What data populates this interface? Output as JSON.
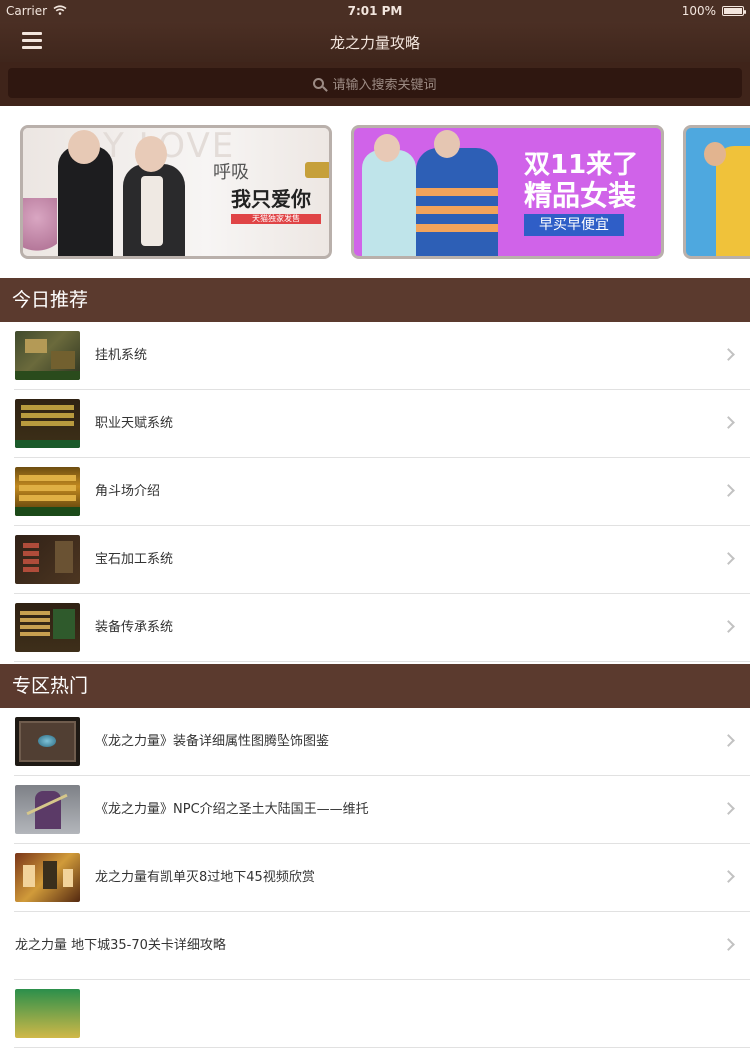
{
  "status_bar": {
    "carrier": "Carrier",
    "time": "7:01 PM",
    "battery": "100%"
  },
  "navbar": {
    "title": "龙之力量攻略"
  },
  "search": {
    "placeholder": "请输入搜索关键词"
  },
  "banners": [
    {
      "headline_top": "呼吸",
      "headline": "我只爱你",
      "bg_word": "Y LOVE",
      "tag": "天猫独家发售"
    },
    {
      "line1": "双11来了",
      "line2": "精品女装",
      "button": "早买早便宜"
    },
    {}
  ],
  "sections": [
    {
      "title": "今日推荐",
      "items": [
        {
          "label": "挂机系统",
          "thumb": "game-screenshot"
        },
        {
          "label": "职业天赋系统",
          "thumb": "game-screenshot"
        },
        {
          "label": "角斗场介绍",
          "thumb": "game-screenshot"
        },
        {
          "label": "宝石加工系统",
          "thumb": "game-screenshot"
        },
        {
          "label": "装备传承系统",
          "thumb": "game-screenshot"
        }
      ]
    },
    {
      "title": "专区热门",
      "items": [
        {
          "label": "《龙之力量》装备详细属性图腾坠饰图鉴",
          "thumb": "pendant-image"
        },
        {
          "label": "《龙之力量》NPC介绍之圣土大陆国王——维托",
          "thumb": "npc-image"
        },
        {
          "label": "龙之力量有凯单灭8过地下45视频欣赏",
          "thumb": "video-image"
        },
        {
          "label": "龙之力量 地下城35-70关卡详细攻略",
          "thumb": ""
        }
      ]
    }
  ],
  "colors": {
    "nav_bg": "#4b2f24",
    "section_header_bg": "#5b3a2e",
    "search_bg": "#2f1710",
    "divider": "#e1e1e1",
    "chevron": "#c2c2c2"
  }
}
